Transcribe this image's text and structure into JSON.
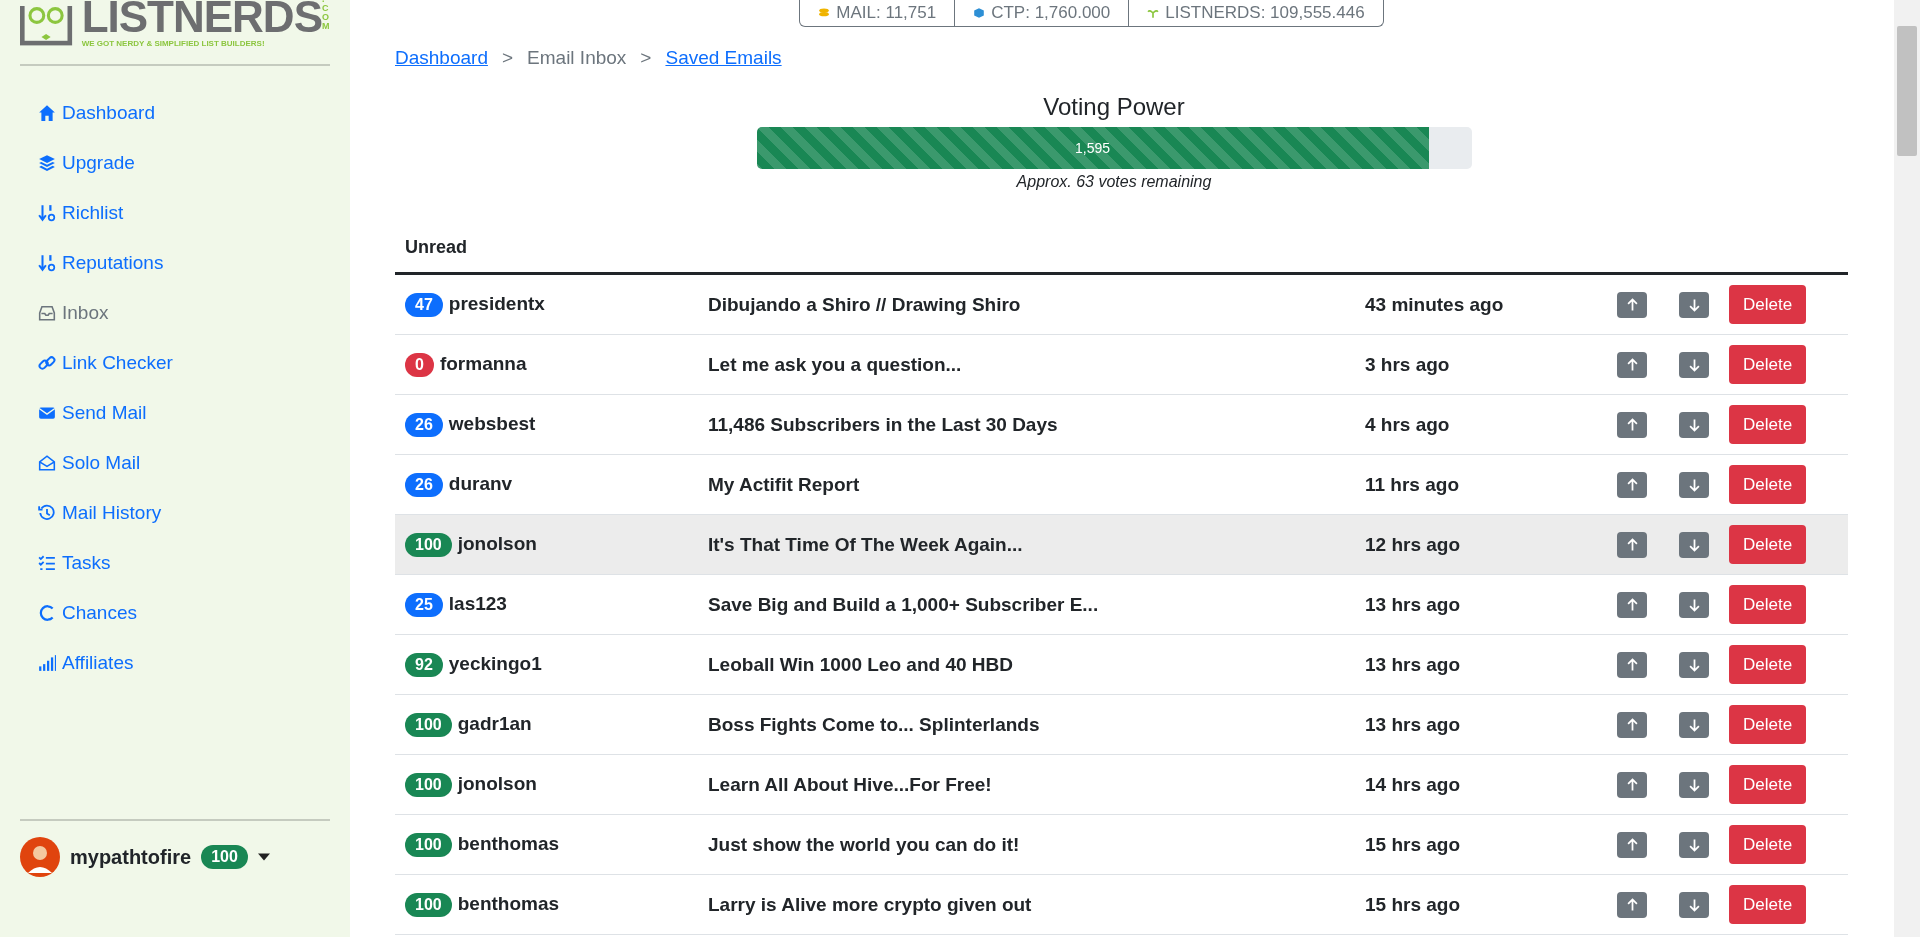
{
  "logo": {
    "name": "LISTNERDS",
    "suffix": ".COM",
    "tagline": "WE GOT NERDY & SIMPLIFIED LIST BUILDERS!"
  },
  "sidebar": {
    "items": [
      {
        "label": "Dashboard",
        "selected": false
      },
      {
        "label": "Upgrade",
        "selected": false
      },
      {
        "label": "Richlist",
        "selected": false
      },
      {
        "label": "Reputations",
        "selected": false
      },
      {
        "label": "Inbox",
        "selected": true
      },
      {
        "label": "Link Checker",
        "selected": false
      },
      {
        "label": "Send Mail",
        "selected": false
      },
      {
        "label": "Solo Mail",
        "selected": false
      },
      {
        "label": "Mail History",
        "selected": false
      },
      {
        "label": "Tasks",
        "selected": false
      },
      {
        "label": "Chances",
        "selected": false
      },
      {
        "label": "Affiliates",
        "selected": false
      }
    ],
    "user": {
      "name": "mypathtofire",
      "reputation": "100"
    }
  },
  "stats": [
    {
      "label": "MAIL: 11,751"
    },
    {
      "label": "CTP: 1,760.000"
    },
    {
      "label": "LISTNERDS: 109,555.446"
    }
  ],
  "breadcrumb": [
    {
      "label": "Dashboard",
      "kind": "link"
    },
    {
      "label": ">",
      "kind": "separator"
    },
    {
      "label": "Email Inbox",
      "kind": "current"
    },
    {
      "label": ">",
      "kind": "separator"
    },
    {
      "label": "Saved Emails",
      "kind": "link"
    }
  ],
  "voting": {
    "title": "Voting Power",
    "value": "1,595",
    "level": 0.94,
    "note": "Approx. 63 votes remaining"
  },
  "table": {
    "heading": "Unread",
    "rows": [
      {
        "rep": "47",
        "color": "#0d6efd",
        "sender": "presidentx",
        "subject": "Dibujando a Shiro // Drawing Shiro",
        "time": "43 minutes ago",
        "action": "Delete",
        "highlighted": false
      },
      {
        "rep": "0",
        "color": "#dc3545",
        "sender": "formanna",
        "subject": "Let me ask you a question...",
        "time": "3 hrs ago",
        "action": "Delete",
        "highlighted": false
      },
      {
        "rep": "26",
        "color": "#0d6efd",
        "sender": "websbest",
        "subject": "11,486 Subscribers in the Last 30 Days",
        "time": "4 hrs ago",
        "action": "Delete",
        "highlighted": false
      },
      {
        "rep": "26",
        "color": "#0d6efd",
        "sender": "duranv",
        "subject": "My Actifit Report",
        "time": "11 hrs ago",
        "action": "Delete",
        "highlighted": false
      },
      {
        "rep": "100",
        "color": "#198754",
        "sender": "jonolson",
        "subject": "It's That Time Of The Week Again...",
        "time": "12 hrs ago",
        "action": "Delete",
        "highlighted": true
      },
      {
        "rep": "25",
        "color": "#0d6efd",
        "sender": "las123",
        "subject": "Save Big and Build a 1,000+ Subscriber E...",
        "time": "13 hrs ago",
        "action": "Delete",
        "highlighted": false
      },
      {
        "rep": "92",
        "color": "#198754",
        "sender": "yeckingo1",
        "subject": "Leoball Win 1000 Leo and 40 HBD",
        "time": "13 hrs ago",
        "action": "Delete",
        "highlighted": false
      },
      {
        "rep": "100",
        "color": "#198754",
        "sender": "gadr1an",
        "subject": "Boss Fights Come to... Splinterlands",
        "time": "13 hrs ago",
        "action": "Delete",
        "highlighted": false
      },
      {
        "rep": "100",
        "color": "#198754",
        "sender": "jonolson",
        "subject": "Learn All About Hive...For Free!",
        "time": "14 hrs ago",
        "action": "Delete",
        "highlighted": false
      },
      {
        "rep": "100",
        "color": "#198754",
        "sender": "benthomas",
        "subject": "Just show the world you can do it!",
        "time": "15 hrs ago",
        "action": "Delete",
        "highlighted": false
      },
      {
        "rep": "100",
        "color": "#198754",
        "sender": "benthomas",
        "subject": "Larry is Alive more crypto given out",
        "time": "15 hrs ago",
        "action": "Delete",
        "highlighted": false
      }
    ]
  }
}
